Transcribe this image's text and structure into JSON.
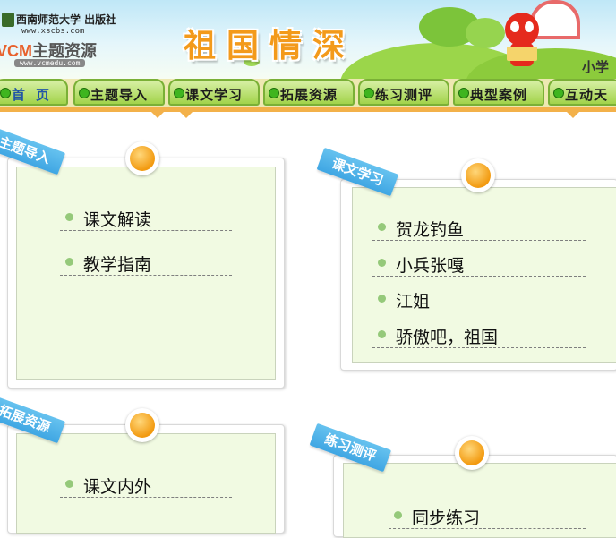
{
  "header": {
    "publisher_name": "西南师范大学 出版社",
    "publisher_url": "www.xscbs.com",
    "brand_part1": "VCM",
    "brand_part2": "主题资源",
    "brand_url": "www.vcmedu.com",
    "title": "祖国情深",
    "grade_label": "小学",
    "colors": {
      "title": "#f39a1b",
      "nav_bg": "#a2d34a",
      "accent": "#f3b14a",
      "ribbon": "#3fa6e3"
    }
  },
  "nav": {
    "items": [
      {
        "label": "首页",
        "icon": "green-dot-icon"
      },
      {
        "label": "主题导入",
        "icon": "green-dot-icon"
      },
      {
        "label": "课文学习",
        "icon": "green-dot-icon"
      },
      {
        "label": "拓展资源",
        "icon": "green-dot-icon"
      },
      {
        "label": "练习测评",
        "icon": "green-dot-icon"
      },
      {
        "label": "典型案例",
        "icon": "green-dot-icon"
      },
      {
        "label": "互动天",
        "icon": "green-dot-icon"
      }
    ]
  },
  "cards": [
    {
      "title": "主题导入",
      "items": [
        "课文解读",
        "教学指南"
      ]
    },
    {
      "title": "课文学习",
      "items": [
        "贺龙钓鱼",
        "小兵张嘎",
        "江姐",
        "骄傲吧，祖国"
      ]
    },
    {
      "title": "拓展资源",
      "items": [
        "课文内外"
      ]
    },
    {
      "title": "练习测评",
      "items": [
        "同步练习"
      ]
    }
  ]
}
